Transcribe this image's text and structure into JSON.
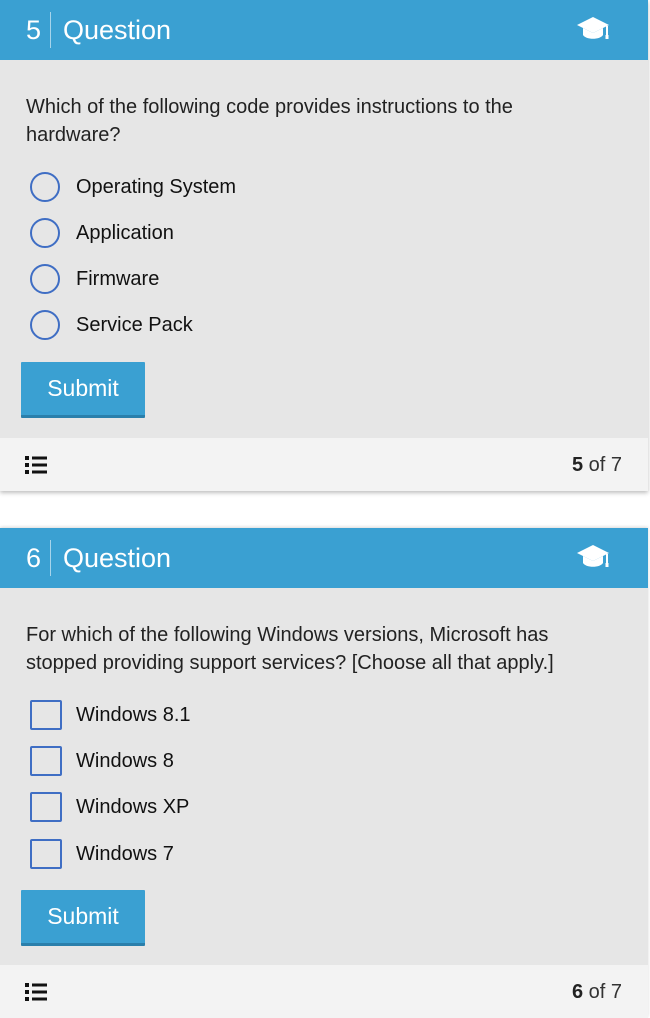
{
  "questions": [
    {
      "number": "5",
      "title": "Question",
      "prompt": "Which of the following code provides instructions to the hardware?",
      "input_type": "radio",
      "options": [
        "Operating System",
        "Application",
        "Firmware",
        "Service Pack"
      ],
      "submit_label": "Submit",
      "pager": {
        "current": "5",
        "separator": "of",
        "total": "7"
      }
    },
    {
      "number": "6",
      "title": "Question",
      "prompt": "For which of the following Windows versions, Microsoft has stopped providing support services? [Choose all that apply.]",
      "input_type": "checkbox",
      "options": [
        "Windows 8.1",
        "Windows 8",
        "Windows XP",
        "Windows 7"
      ],
      "submit_label": "Submit",
      "pager": {
        "current": "6",
        "separator": "of",
        "total": "7"
      }
    }
  ],
  "icons": {
    "header": "graduation-cap-icon",
    "footer": "list-icon"
  },
  "colors": {
    "header_bg": "#3aa0d2",
    "card_bg": "#e6e6e6",
    "footer_bg": "#f3f3f3",
    "input_border": "#3f6ec4",
    "button_bg": "#3aa0d2"
  }
}
